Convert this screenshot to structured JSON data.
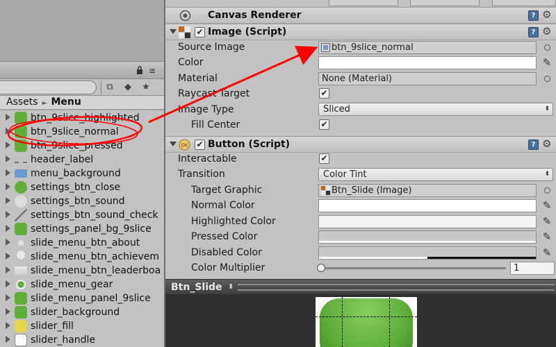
{
  "colors": {
    "annotation_red": "#ff0000",
    "accent_green": "#5fae3a"
  },
  "project": {
    "breadcrumb": {
      "root": "Assets",
      "current": "Menu"
    },
    "toolbar_icons": [
      "filter-by-type-icon",
      "filter-by-label-icon",
      "favorite-star-icon"
    ],
    "items": [
      {
        "label": "btn_9slice_highlighted",
        "icon": "sprite-green"
      },
      {
        "label": "btn_9slice_normal",
        "icon": "sprite-green"
      },
      {
        "label": "btn_9slice_pressed",
        "icon": "sprite-green"
      },
      {
        "label": "header_label",
        "icon": "sprite-label"
      },
      {
        "label": "menu_background",
        "icon": "sprite-blue"
      },
      {
        "label": "settings_btn_close",
        "icon": "sprite-close"
      },
      {
        "label": "settings_btn_sound",
        "icon": "sprite-sound"
      },
      {
        "label": "settings_btn_sound_check",
        "icon": "sprite-line"
      },
      {
        "label": "settings_panel_bg_9slice",
        "icon": "sprite-green"
      },
      {
        "label": "slide_menu_btn_about",
        "icon": "sprite-info"
      },
      {
        "label": "slide_menu_btn_achievem",
        "icon": "sprite-trophy"
      },
      {
        "label": "slide_menu_btn_leaderboa",
        "icon": "sprite-board"
      },
      {
        "label": "slide_menu_gear",
        "icon": "sprite-gear"
      },
      {
        "label": "slide_menu_panel_9slice",
        "icon": "sprite-green"
      },
      {
        "label": "slider_background",
        "icon": "sprite-green"
      },
      {
        "label": "slider_fill",
        "icon": "sprite-yellow"
      },
      {
        "label": "slider_handle",
        "icon": "sprite-white"
      }
    ]
  },
  "inspector": {
    "canvas_renderer": {
      "title": "Canvas Renderer"
    },
    "image": {
      "title": "Image (Script)",
      "source_image_label": "Source Image",
      "source_image_value": "btn_9slice_normal",
      "color_label": "Color",
      "material_label": "Material",
      "material_value": "None (Material)",
      "raycast_label": "Raycast Target",
      "raycast_checked": true,
      "image_type_label": "Image Type",
      "image_type_value": "Sliced",
      "fill_center_label": "Fill Center",
      "fill_center_checked": true
    },
    "button": {
      "title": "Button (Script)",
      "interactable_label": "Interactable",
      "interactable_checked": true,
      "transition_label": "Transition",
      "transition_value": "Color Tint",
      "target_graphic_label": "Target Graphic",
      "target_graphic_value": "Btn_Slide (Image)",
      "normal_color_label": "Normal Color",
      "highlighted_color_label": "Highlighted Color",
      "pressed_color_label": "Pressed Color",
      "disabled_color_label": "Disabled Color",
      "color_multiplier_label": "Color Multiplier",
      "color_multiplier_value": "1",
      "normal_color": "#ffffff",
      "highlighted_color": "#f5f5f5",
      "pressed_color": "#c8c8c8",
      "disabled_color": "#c8c8c8"
    }
  },
  "preview": {
    "title": "Btn_Slide"
  }
}
